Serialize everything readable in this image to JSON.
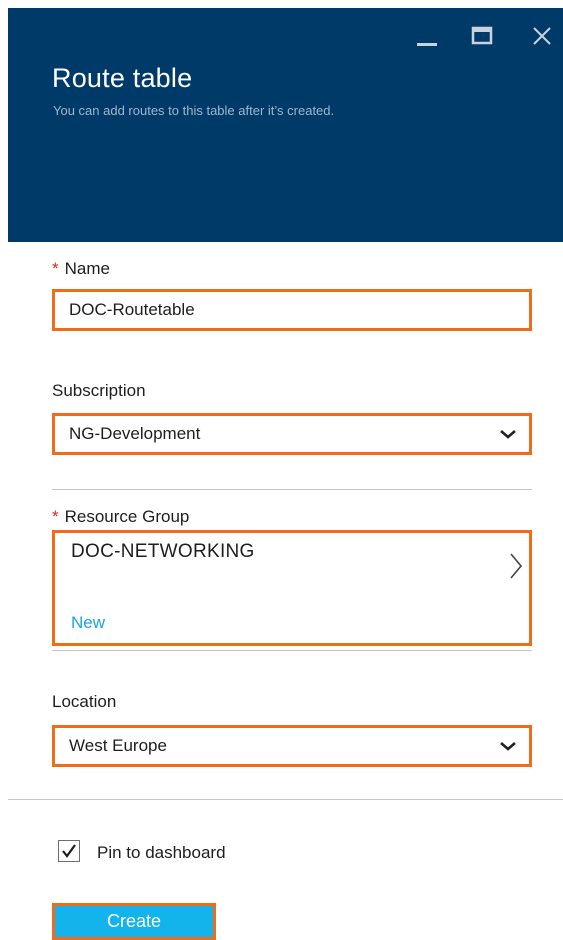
{
  "blade": {
    "title": "Route table",
    "subtitle": "You can add routes to this table after it’s created."
  },
  "window_controls": [
    "minimize-icon",
    "maximize-icon",
    "close-icon"
  ],
  "form": {
    "name": {
      "required_mark": "*",
      "label": "Name",
      "value": "DOC-Routetable"
    },
    "subscription": {
      "label": "Subscription",
      "value": "NG-Development"
    },
    "resource_group": {
      "required_mark": "*",
      "label": "Resource Group",
      "value": "DOC-NETWORKING",
      "new_link": "New"
    },
    "location": {
      "label": "Location",
      "value": "West Europe"
    },
    "pin": {
      "label": "Pin to dashboard",
      "checked": true
    },
    "create_label": "Create"
  },
  "colors": {
    "header_bg": "#003a69",
    "highlight_border": "#ef6c1a",
    "required": "#d9281e",
    "link": "#1aa3e8",
    "button_bg": "#13b4ec"
  }
}
